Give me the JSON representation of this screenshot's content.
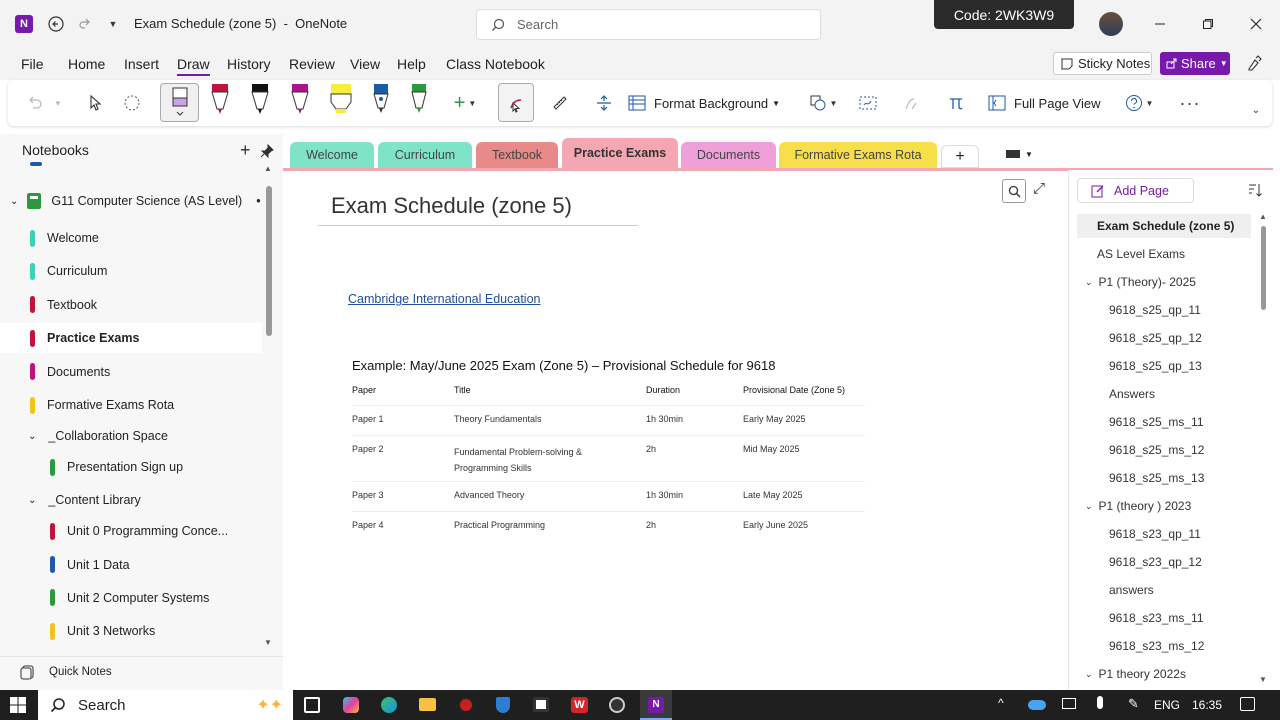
{
  "window": {
    "title": "Exam Schedule (zone 5)  -  OneNote",
    "search_placeholder": "Search",
    "code_label": "Code: 2WK3W9",
    "app_badge": "N"
  },
  "menu": {
    "items": [
      "File",
      "Home",
      "Insert",
      "Draw",
      "History",
      "Review",
      "View",
      "Help",
      "Class Notebook"
    ],
    "active": "Draw",
    "sticky_notes": "Sticky Notes",
    "share": "Share"
  },
  "ribbon": {
    "format_background": "Format Background",
    "full_page_view": "Full Page View"
  },
  "sidebar": {
    "title": "Notebooks",
    "notebook": "G11 Computer Science (AS Level)",
    "sections": [
      {
        "label": "Welcome",
        "color": "#3fd0b5"
      },
      {
        "label": "Curriculum",
        "color": "#3fd0b5"
      },
      {
        "label": "Textbook",
        "color": "#c0143c"
      },
      {
        "label": "Practice Exams",
        "color": "#c0143c"
      },
      {
        "label": "Documents",
        "color": "#c0147a"
      },
      {
        "label": "Formative Exams Rota",
        "color": "#f0c419"
      }
    ],
    "groups": [
      {
        "label": "_Collaboration Space",
        "items": [
          {
            "label": "Presentation Sign up",
            "color": "#2b9a3e"
          }
        ]
      },
      {
        "label": "_Content Library",
        "items": [
          {
            "label": "Unit 0 Programming Conce...",
            "color": "#c0143c"
          },
          {
            "label": "Unit 1 Data",
            "color": "#1c5aa6"
          },
          {
            "label": "Unit 2 Computer Systems",
            "color": "#2b9a3e"
          },
          {
            "label": "Unit 3 Networks",
            "color": "#f0c419"
          }
        ]
      }
    ],
    "quick_notes": "Quick Notes"
  },
  "tabs": [
    {
      "label": "Welcome",
      "color": "#7fe3c8"
    },
    {
      "label": "Curriculum",
      "color": "#7fe3c8"
    },
    {
      "label": "Textbook",
      "color": "#e88a8a"
    },
    {
      "label": "Practice Exams",
      "color": "#f4a7b3"
    },
    {
      "label": "Documents",
      "color": "#f0a0d8"
    },
    {
      "label": "Formative Exams Rota",
      "color": "#f7df4a"
    }
  ],
  "page": {
    "title": "Exam Schedule (zone 5)",
    "link": "Cambridge International Education",
    "heading": "Example: May/June 2025 Exam (Zone 5) – Provisional Schedule for 9618",
    "table": {
      "headers": [
        "Paper",
        "Title",
        "Duration",
        "Provisional Date (Zone 5)"
      ],
      "rows": [
        [
          "Paper 1",
          "Theory Fundamentals",
          "1h 30min",
          "Early May 2025"
        ],
        [
          "Paper 2",
          "Fundamental Problem-solving & Programming Skills",
          "2h",
          "Mid May 2025"
        ],
        [
          "Paper 3",
          "Advanced Theory",
          "1h 30min",
          "Late May 2025"
        ],
        [
          "Paper 4",
          "Practical Programming",
          "2h",
          "Early June 2025"
        ]
      ]
    }
  },
  "pages": {
    "add_page": "Add Page",
    "items": [
      {
        "label": "Exam Schedule (zone 5)",
        "level": 0,
        "selected": true
      },
      {
        "label": "AS Level Exams",
        "level": 0
      },
      {
        "label": "P1 (Theory)- 2025",
        "level": 0,
        "group": true
      },
      {
        "label": "9618_s25_qp_11",
        "level": 1
      },
      {
        "label": "9618_s25_qp_12",
        "level": 1
      },
      {
        "label": "9618_s25_qp_13",
        "level": 1
      },
      {
        "label": "Answers",
        "level": 1
      },
      {
        "label": "9618_s25_ms_11",
        "level": 1
      },
      {
        "label": "9618_s25_ms_12",
        "level": 1
      },
      {
        "label": "9618_s25_ms_13",
        "level": 1
      },
      {
        "label": "P1 (theory ) 2023",
        "level": 0,
        "group": true
      },
      {
        "label": "9618_s23_qp_11",
        "level": 1
      },
      {
        "label": "9618_s23_qp_12",
        "level": 1
      },
      {
        "label": "answers",
        "level": 1
      },
      {
        "label": "9618_s23_ms_11",
        "level": 1
      },
      {
        "label": "9618_s23_ms_12",
        "level": 1
      },
      {
        "label": "P1 theory 2022s",
        "level": 0,
        "group": true
      }
    ]
  },
  "taskbar": {
    "search": "Search",
    "lang": "ENG",
    "time": "16:35"
  }
}
